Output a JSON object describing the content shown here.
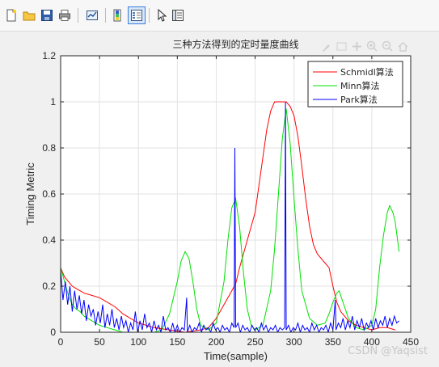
{
  "toolbar": {
    "icons": [
      "new-file-icon",
      "open-folder-icon",
      "save-icon",
      "print-icon",
      "link-plot-icon",
      "insert-colorbar-icon",
      "insert-legend-icon",
      "pointer-icon",
      "property-inspector-icon"
    ]
  },
  "axes_toolbar": {
    "icons": [
      "brush-icon",
      "datatip-icon",
      "pan-icon",
      "zoom-in-icon",
      "zoom-out-icon",
      "home-icon"
    ]
  },
  "watermark": "CSDN @Yaqsist",
  "chart_data": {
    "type": "line",
    "title": "三种方法得到的定时量度曲线",
    "xlabel": "Time(sample)",
    "ylabel": "Timing Metric",
    "xlim": [
      0,
      450
    ],
    "ylim": [
      0,
      1.2
    ],
    "xticks": [
      "0",
      "50",
      "100",
      "150",
      "200",
      "250",
      "300",
      "350",
      "400",
      "450"
    ],
    "yticks": [
      "0",
      "0.2",
      "0.4",
      "0.6",
      "0.8",
      "1",
      "1.2"
    ],
    "grid": true,
    "legend_position": "top-right",
    "series": [
      {
        "name": "Schmidl算法",
        "color": "#ff0000",
        "points": [
          [
            0,
            0.28
          ],
          [
            5,
            0.24
          ],
          [
            10,
            0.22
          ],
          [
            15,
            0.2
          ],
          [
            20,
            0.19
          ],
          [
            25,
            0.18
          ],
          [
            30,
            0.17
          ],
          [
            40,
            0.16
          ],
          [
            50,
            0.15
          ],
          [
            60,
            0.13
          ],
          [
            70,
            0.11
          ],
          [
            80,
            0.08
          ],
          [
            90,
            0.06
          ],
          [
            100,
            0.04
          ],
          [
            110,
            0.03
          ],
          [
            120,
            0.02
          ],
          [
            140,
            0.01
          ],
          [
            160,
            0.0
          ],
          [
            180,
            0.01
          ],
          [
            190,
            0.02
          ],
          [
            200,
            0.06
          ],
          [
            210,
            0.12
          ],
          [
            220,
            0.18
          ],
          [
            225,
            0.21
          ],
          [
            230,
            0.28
          ],
          [
            240,
            0.4
          ],
          [
            250,
            0.52
          ],
          [
            255,
            0.64
          ],
          [
            260,
            0.76
          ],
          [
            265,
            0.88
          ],
          [
            270,
            0.96
          ],
          [
            275,
            1.0
          ],
          [
            285,
            1.0
          ],
          [
            290,
            1.0
          ],
          [
            295,
            0.98
          ],
          [
            300,
            0.94
          ],
          [
            305,
            0.85
          ],
          [
            310,
            0.72
          ],
          [
            315,
            0.58
          ],
          [
            320,
            0.46
          ],
          [
            325,
            0.38
          ],
          [
            330,
            0.34
          ],
          [
            335,
            0.32
          ],
          [
            340,
            0.3
          ],
          [
            345,
            0.28
          ],
          [
            350,
            0.2
          ],
          [
            355,
            0.13
          ],
          [
            360,
            0.09
          ],
          [
            370,
            0.05
          ],
          [
            380,
            0.03
          ],
          [
            390,
            0.02
          ],
          [
            400,
            0.01
          ],
          [
            410,
            0.02
          ],
          [
            420,
            0.02
          ],
          [
            430,
            0.01
          ]
        ]
      },
      {
        "name": "Minn算法",
        "color": "#00e000",
        "points": [
          [
            0,
            0.28
          ],
          [
            5,
            0.22
          ],
          [
            10,
            0.16
          ],
          [
            15,
            0.12
          ],
          [
            20,
            0.1
          ],
          [
            25,
            0.09
          ],
          [
            30,
            0.07
          ],
          [
            40,
            0.05
          ],
          [
            50,
            0.03
          ],
          [
            60,
            0.02
          ],
          [
            70,
            0.01
          ],
          [
            80,
            0.0
          ],
          [
            100,
            0.0
          ],
          [
            120,
            0.0
          ],
          [
            130,
            0.01
          ],
          [
            140,
            0.08
          ],
          [
            150,
            0.22
          ],
          [
            155,
            0.31
          ],
          [
            160,
            0.35
          ],
          [
            165,
            0.32
          ],
          [
            170,
            0.22
          ],
          [
            175,
            0.1
          ],
          [
            180,
            0.03
          ],
          [
            190,
            0.01
          ],
          [
            200,
            0.04
          ],
          [
            210,
            0.22
          ],
          [
            215,
            0.4
          ],
          [
            220,
            0.54
          ],
          [
            225,
            0.58
          ],
          [
            230,
            0.46
          ],
          [
            235,
            0.26
          ],
          [
            240,
            0.1
          ],
          [
            245,
            0.03
          ],
          [
            250,
            0.01
          ],
          [
            260,
            0.03
          ],
          [
            270,
            0.18
          ],
          [
            275,
            0.36
          ],
          [
            280,
            0.6
          ],
          [
            285,
            0.84
          ],
          [
            290,
            0.97
          ],
          [
            295,
            0.82
          ],
          [
            300,
            0.58
          ],
          [
            305,
            0.36
          ],
          [
            310,
            0.18
          ],
          [
            320,
            0.06
          ],
          [
            330,
            0.03
          ],
          [
            340,
            0.04
          ],
          [
            345,
            0.08
          ],
          [
            350,
            0.13
          ],
          [
            355,
            0.17
          ],
          [
            358,
            0.18
          ],
          [
            362,
            0.14
          ],
          [
            370,
            0.06
          ],
          [
            380,
            0.02
          ],
          [
            390,
            0.01
          ],
          [
            400,
            0.03
          ],
          [
            405,
            0.1
          ],
          [
            410,
            0.28
          ],
          [
            415,
            0.42
          ],
          [
            420,
            0.52
          ],
          [
            423,
            0.55
          ],
          [
            427,
            0.52
          ],
          [
            430,
            0.48
          ],
          [
            435,
            0.35
          ]
        ]
      },
      {
        "name": "Park算法",
        "color": "#0000ff",
        "points": [
          [
            0,
            0.27
          ],
          [
            3,
            0.14
          ],
          [
            6,
            0.22
          ],
          [
            9,
            0.12
          ],
          [
            12,
            0.2
          ],
          [
            15,
            0.09
          ],
          [
            18,
            0.18
          ],
          [
            21,
            0.1
          ],
          [
            24,
            0.16
          ],
          [
            27,
            0.08
          ],
          [
            30,
            0.14
          ],
          [
            33,
            0.05
          ],
          [
            36,
            0.12
          ],
          [
            39,
            0.07
          ],
          [
            42,
            0.1
          ],
          [
            45,
            0.03
          ],
          [
            48,
            0.09
          ],
          [
            51,
            0.04
          ],
          [
            54,
            0.12
          ],
          [
            57,
            0.02
          ],
          [
            60,
            0.08
          ],
          [
            63,
            0.03
          ],
          [
            66,
            0.1
          ],
          [
            69,
            0.02
          ],
          [
            72,
            0.06
          ],
          [
            75,
            0.01
          ],
          [
            78,
            0.07
          ],
          [
            81,
            0.02
          ],
          [
            84,
            0.05
          ],
          [
            87,
            0.0
          ],
          [
            90,
            0.04
          ],
          [
            93,
            0.01
          ],
          [
            96,
            0.09
          ],
          [
            99,
            0.0
          ],
          [
            102,
            0.05
          ],
          [
            105,
            0.01
          ],
          [
            108,
            0.08
          ],
          [
            111,
            0.02
          ],
          [
            114,
            0.04
          ],
          [
            117,
            0.0
          ],
          [
            120,
            0.05
          ],
          [
            123,
            0.01
          ],
          [
            126,
            0.03
          ],
          [
            129,
            0.0
          ],
          [
            132,
            0.07
          ],
          [
            135,
            0.01
          ],
          [
            138,
            0.02
          ],
          [
            141,
            0.0
          ],
          [
            144,
            0.04
          ],
          [
            147,
            0.0
          ],
          [
            150,
            0.03
          ],
          [
            153,
            0.0
          ],
          [
            156,
            0.02
          ],
          [
            159,
            0.01
          ],
          [
            162,
            0.15
          ],
          [
            163,
            0.0
          ],
          [
            166,
            0.03
          ],
          [
            169,
            0.0
          ],
          [
            172,
            0.02
          ],
          [
            175,
            0.01
          ],
          [
            178,
            0.04
          ],
          [
            181,
            0.0
          ],
          [
            184,
            0.03
          ],
          [
            187,
            0.01
          ],
          [
            190,
            0.02
          ],
          [
            193,
            0.0
          ],
          [
            196,
            0.04
          ],
          [
            199,
            0.01
          ],
          [
            202,
            0.02
          ],
          [
            205,
            0.0
          ],
          [
            208,
            0.03
          ],
          [
            211,
            0.01
          ],
          [
            214,
            0.02
          ],
          [
            217,
            0.0
          ],
          [
            220,
            0.04
          ],
          [
            223,
            0.02
          ],
          [
            224,
            0.8
          ],
          [
            225,
            0.02
          ],
          [
            228,
            0.04
          ],
          [
            231,
            0.0
          ],
          [
            234,
            0.03
          ],
          [
            237,
            0.01
          ],
          [
            240,
            0.02
          ],
          [
            243,
            0.0
          ],
          [
            246,
            0.03
          ],
          [
            249,
            0.01
          ],
          [
            252,
            0.02
          ],
          [
            255,
            0.0
          ],
          [
            258,
            0.04
          ],
          [
            261,
            0.01
          ],
          [
            264,
            0.03
          ],
          [
            267,
            0.0
          ],
          [
            270,
            0.02
          ],
          [
            273,
            0.01
          ],
          [
            276,
            0.03
          ],
          [
            279,
            0.0
          ],
          [
            282,
            0.02
          ],
          [
            285,
            0.01
          ],
          [
            288,
            0.02
          ],
          [
            289,
            1.0
          ],
          [
            290,
            0.01
          ],
          [
            293,
            0.03
          ],
          [
            296,
            0.0
          ],
          [
            299,
            0.02
          ],
          [
            302,
            0.01
          ],
          [
            305,
            0.04
          ],
          [
            308,
            0.0
          ],
          [
            311,
            0.03
          ],
          [
            314,
            0.01
          ],
          [
            317,
            0.02
          ],
          [
            320,
            0.0
          ],
          [
            323,
            0.04
          ],
          [
            326,
            0.01
          ],
          [
            329,
            0.03
          ],
          [
            332,
            0.0
          ],
          [
            335,
            0.02
          ],
          [
            338,
            0.01
          ],
          [
            341,
            0.03
          ],
          [
            344,
            0.0
          ],
          [
            347,
            0.04
          ],
          [
            350,
            0.01
          ],
          [
            353,
            0.14
          ],
          [
            354,
            0.01
          ],
          [
            357,
            0.04
          ],
          [
            360,
            0.02
          ],
          [
            363,
            0.06
          ],
          [
            366,
            0.01
          ],
          [
            369,
            0.05
          ],
          [
            372,
            0.02
          ],
          [
            375,
            0.07
          ],
          [
            378,
            0.01
          ],
          [
            381,
            0.05
          ],
          [
            384,
            0.02
          ],
          [
            387,
            0.06
          ],
          [
            390,
            0.01
          ],
          [
            393,
            0.04
          ],
          [
            396,
            0.02
          ],
          [
            399,
            0.05
          ],
          [
            402,
            0.01
          ],
          [
            405,
            0.06
          ],
          [
            408,
            0.02
          ],
          [
            411,
            0.05
          ],
          [
            414,
            0.03
          ],
          [
            417,
            0.07
          ],
          [
            420,
            0.02
          ],
          [
            423,
            0.06
          ],
          [
            426,
            0.03
          ],
          [
            429,
            0.07
          ],
          [
            432,
            0.04
          ],
          [
            435,
            0.05
          ]
        ]
      }
    ]
  }
}
